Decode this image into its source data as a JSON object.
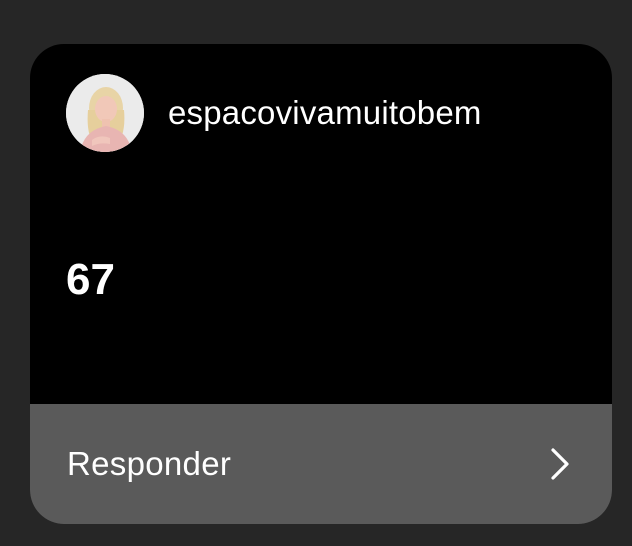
{
  "story_reply": {
    "username": "espacovivamuitobem",
    "message": "67",
    "reply_label": "Responder",
    "avatar_icon": "profile-photo",
    "chevron_icon": "chevron-right-icon"
  },
  "colors": {
    "page_background": "#262626",
    "card_background": "#000000",
    "reply_bar_background": "#5a5a5a",
    "text": "#ffffff"
  }
}
